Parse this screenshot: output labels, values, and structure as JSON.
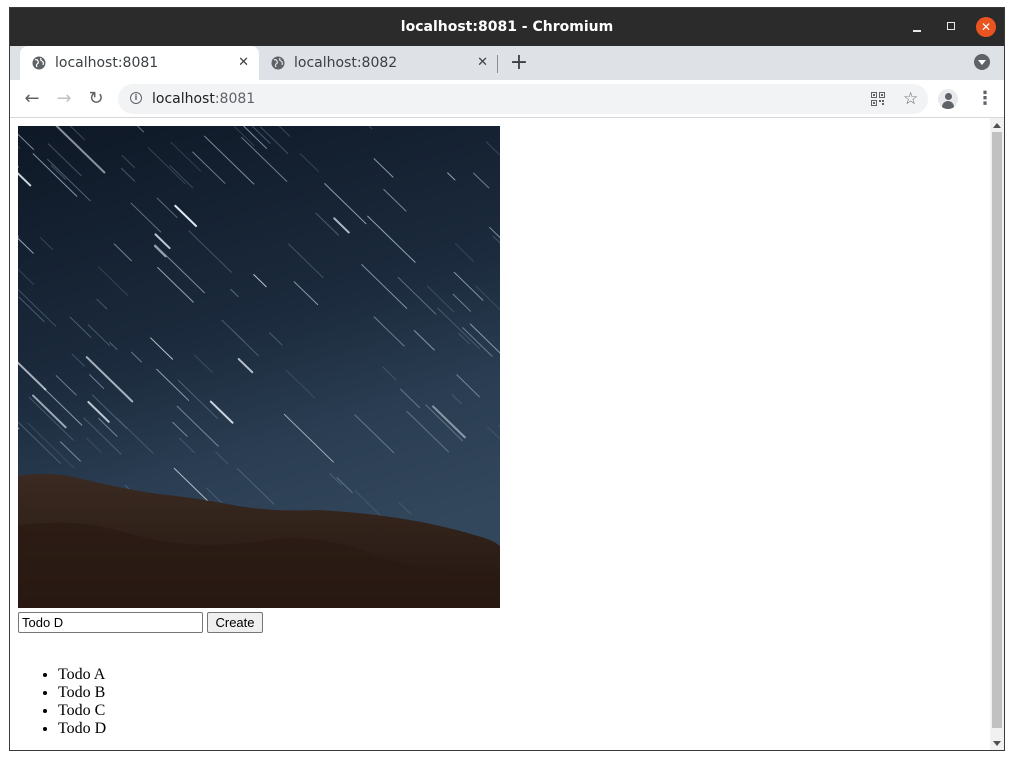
{
  "window": {
    "title": "localhost:8081 - Chromium",
    "controls": {
      "minimize_icon": "minimize-icon",
      "maximize_icon": "maximize-icon",
      "close_icon": "close-icon"
    },
    "close_color": "#e95420"
  },
  "tabs": [
    {
      "label": "localhost:8081",
      "active": true,
      "icon": "globe-icon"
    },
    {
      "label": "localhost:8082",
      "active": false,
      "icon": "globe-icon"
    }
  ],
  "toolbar": {
    "url_host": "localhost",
    "url_port": ":8081",
    "icons": [
      "back-arrow-icon",
      "forward-arrow-icon",
      "reload-icon",
      "site-info-icon",
      "qr-code-icon",
      "bookmark-star-icon",
      "profile-icon",
      "menu-dots-icon"
    ]
  },
  "page": {
    "image_alt": "star-trails-over-mountains",
    "input_value": "Todo D",
    "create_label": "Create",
    "todos": [
      "Todo A",
      "Todo B",
      "Todo C",
      "Todo D"
    ]
  }
}
